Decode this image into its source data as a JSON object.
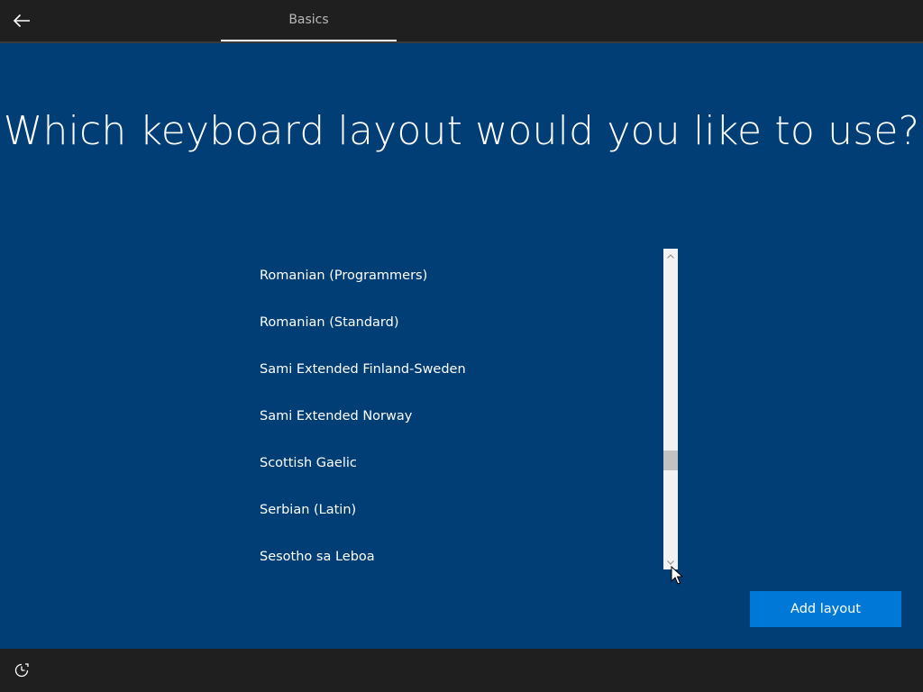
{
  "header": {
    "back_icon": "arrow-left-icon",
    "tab_label": "Basics"
  },
  "main": {
    "title": "Which keyboard layout would you like to use?",
    "layouts": [
      "Romanian (Programmers)",
      "Romanian (Standard)",
      "Sami Extended Finland-Sweden",
      "Sami Extended Norway",
      "Scottish Gaelic",
      "Serbian (Latin)",
      "Sesotho sa Leboa"
    ],
    "add_button_label": "Add layout"
  },
  "footer": {
    "accessibility_icon": "ease-of-access-icon"
  },
  "colors": {
    "background": "#003e75",
    "topbar": "#1f1f1f",
    "accent_button": "#0078d7"
  }
}
